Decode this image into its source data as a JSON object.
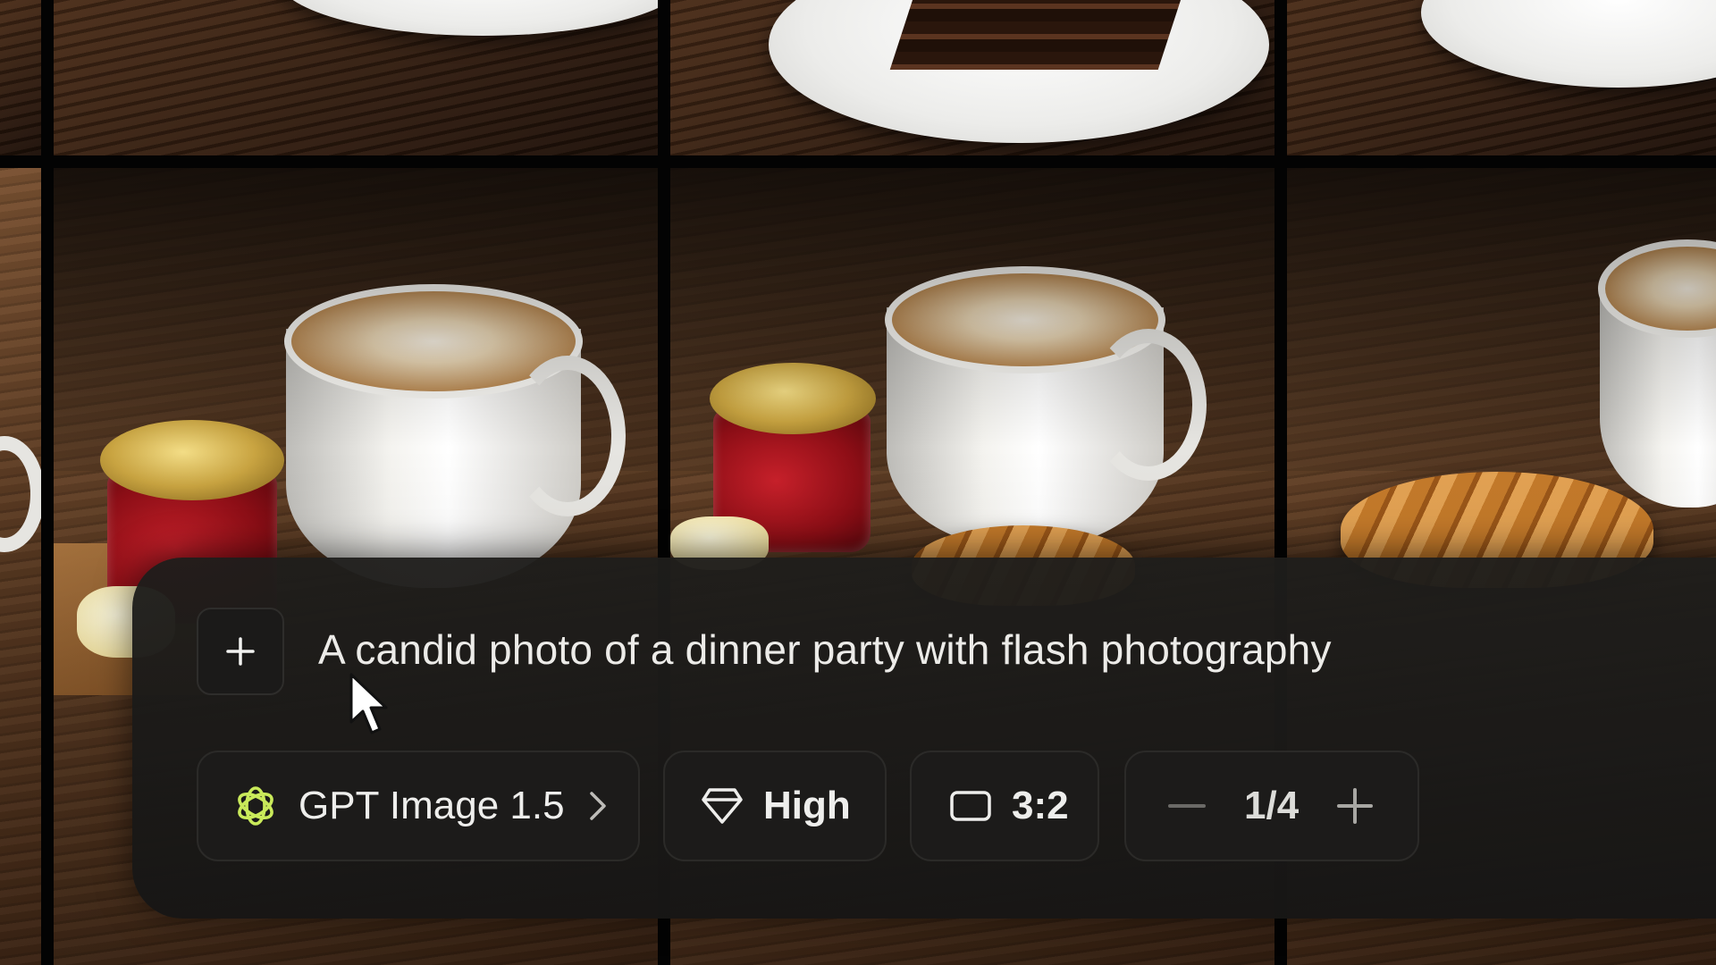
{
  "prompt": {
    "add_label": "+",
    "text": "A candid photo of a dinner party with flash photography"
  },
  "toolbar": {
    "model": {
      "label": "GPT Image 1.5",
      "icon": "openai-logo-icon",
      "chevron": "chevron-right-icon"
    },
    "quality": {
      "label": "High",
      "icon": "diamond-icon"
    },
    "aspect_ratio": {
      "label": "3:2",
      "icon": "rectangle-icon"
    },
    "count": {
      "decrement": "−",
      "value": "1/4",
      "increment": "+"
    }
  },
  "colors": {
    "panel_bg": "#1e1d1b",
    "text": "#ecebe8",
    "openai_logo": "#c9ea5a"
  },
  "background": {
    "description_tiles": [
      "chocolate-cake",
      "latte-jam-butter",
      "latte-croissant"
    ]
  }
}
